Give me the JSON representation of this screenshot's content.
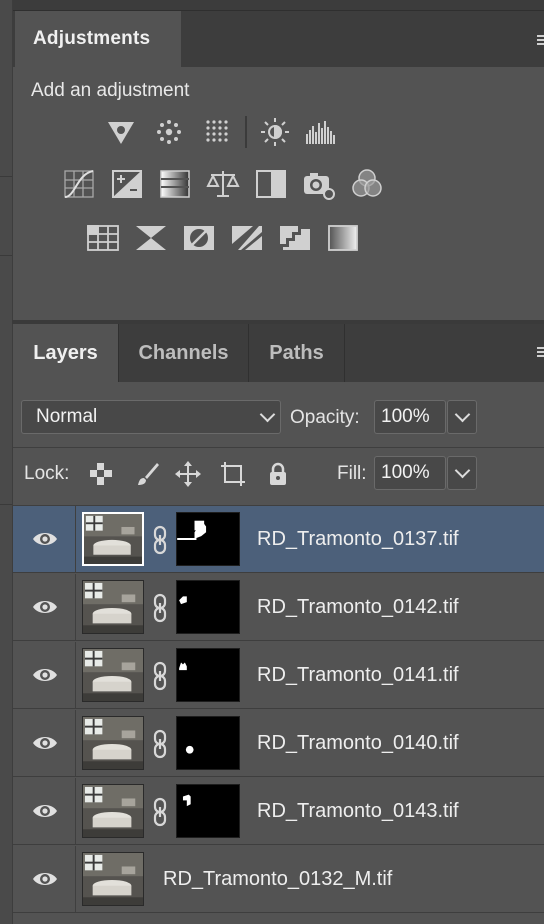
{
  "adjustments": {
    "tab_label": "Adjustments",
    "subtitle": "Add an adjustment",
    "row1": [
      "brightness-contrast-icon",
      "levels-dots-icon",
      "exposure-dots-icon",
      "vibrance-icon",
      "histogram-icon"
    ],
    "row2": [
      "curves-icon",
      "exposure-icon",
      "gradient-bars-icon",
      "color-balance-icon",
      "black-white-icon",
      "photo-filter-icon",
      "channel-mixer-icon"
    ],
    "row3": [
      "color-lookup-icon",
      "invert-icon",
      "posterize-icon",
      "threshold-icon",
      "selective-color-icon",
      "gradient-map-icon"
    ]
  },
  "layers_panel": {
    "tabs": [
      {
        "label": "Layers",
        "active": true
      },
      {
        "label": "Channels",
        "active": false
      },
      {
        "label": "Paths",
        "active": false
      }
    ],
    "blend_mode": "Normal",
    "opacity_label": "Opacity:",
    "opacity_value": "100%",
    "lock_label": "Lock:",
    "fill_label": "Fill:",
    "fill_value": "100%",
    "layers": [
      {
        "name": "RD_Tramonto_0137.tif",
        "selected": true,
        "has_mask": true
      },
      {
        "name": "RD_Tramonto_0142.tif",
        "selected": false,
        "has_mask": true
      },
      {
        "name": "RD_Tramonto_0141.tif",
        "selected": false,
        "has_mask": true
      },
      {
        "name": "RD_Tramonto_0140.tif",
        "selected": false,
        "has_mask": true
      },
      {
        "name": "RD_Tramonto_0143.tif",
        "selected": false,
        "has_mask": true
      },
      {
        "name": "RD_Tramonto_0132_M.tif",
        "selected": false,
        "has_mask": false
      }
    ]
  }
}
